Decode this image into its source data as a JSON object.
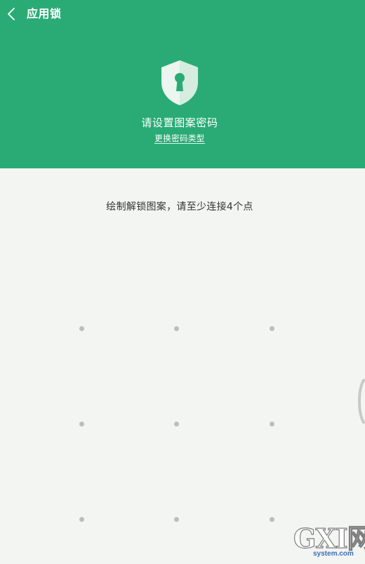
{
  "header": {
    "title": "应用锁",
    "background_color": "#2aab76",
    "lock_icon": "shield-keyhole-icon",
    "heading": "请设置图案密码",
    "change_link": "更换密码类型"
  },
  "pattern": {
    "instruction": "绘制解锁图案，请至少连接4个点",
    "dots": [
      {
        "row": 1,
        "col": 1
      },
      {
        "row": 1,
        "col": 2
      },
      {
        "row": 1,
        "col": 3
      },
      {
        "row": 2,
        "col": 1
      },
      {
        "row": 2,
        "col": 2
      },
      {
        "row": 2,
        "col": 3
      },
      {
        "row": 3,
        "col": 1
      },
      {
        "row": 3,
        "col": 2
      },
      {
        "row": 3,
        "col": 3
      }
    ],
    "dot_color": "#bdbdbd"
  },
  "watermark": {
    "main": "GXI网",
    "sub": "system.com"
  }
}
